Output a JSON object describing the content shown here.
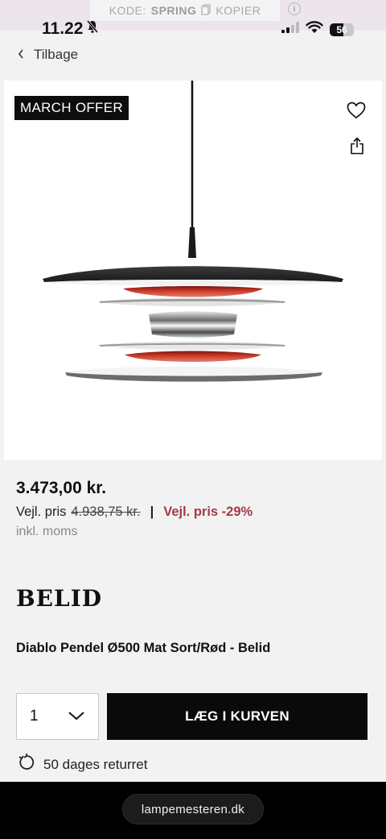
{
  "promo": {
    "code_label": "KODE:",
    "code_value": "SPRING",
    "copy_label": "KOPIER",
    "info_glyph": "i"
  },
  "status_bar": {
    "time": "11.22",
    "battery": "56",
    "battery_level": 0.56
  },
  "nav": {
    "back_label": "Tilbage"
  },
  "product": {
    "badge": "MARCH OFFER",
    "price": "3.473,00 kr.",
    "rrp_label": "Vejl. pris",
    "rrp_value": "4.938,75 kr.",
    "separator": "|",
    "discount": "Vejl. pris -29%",
    "vat_note": "inkl. moms",
    "brand": "BELID",
    "title": "Diablo Pendel Ø500 Mat Sort/Rød - Belid"
  },
  "purchase": {
    "quantity": "1",
    "add_to_cart": "LÆG I KURVEN",
    "returns": "50 dages returret"
  },
  "browser": {
    "url": "lampemesteren.dk"
  },
  "colors": {
    "accent_discount": "#a33a48",
    "button_bg": "#0a0a0a",
    "promo_bg": "#ece6ec"
  },
  "icons": [
    "copy-icon",
    "info-icon",
    "mute-bell-icon",
    "signal-icon",
    "wifi-icon",
    "battery-icon",
    "chevron-left-icon",
    "heart-icon",
    "share-icon",
    "chevron-down-icon",
    "return-arrow-icon"
  ]
}
